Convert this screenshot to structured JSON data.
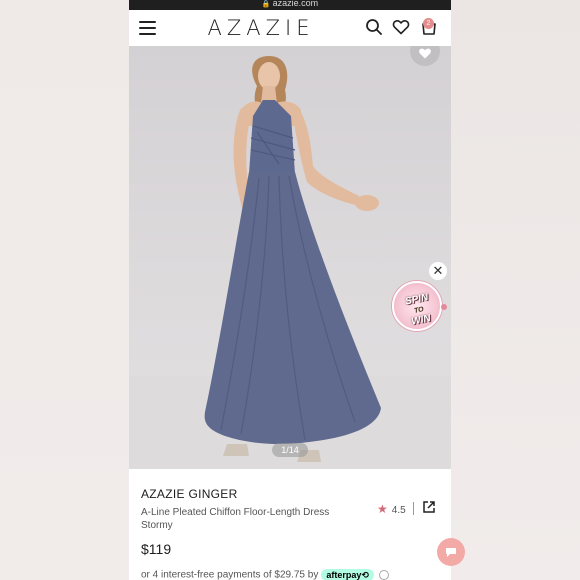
{
  "browser": {
    "url": "azazie.com"
  },
  "header": {
    "logo": "AZAZIE",
    "cart_count": "2"
  },
  "gallery": {
    "counter": "1/14"
  },
  "promo": {
    "line1": "SPIN",
    "line2": "TO",
    "line3": "WIN"
  },
  "product": {
    "brand": "AZAZIE GINGER",
    "name": "A-Line Pleated Chiffon Floor-Length Dress Stormy",
    "rating": "4.5",
    "price": "$119",
    "afterpay_text": "or 4 interest-free payments of $29.75 by",
    "afterpay_badge": "afterpay⟲"
  },
  "colors": {
    "dress": "#5f6a8e",
    "accent": "#e48b8b",
    "afterpay": "#b2fce4"
  }
}
